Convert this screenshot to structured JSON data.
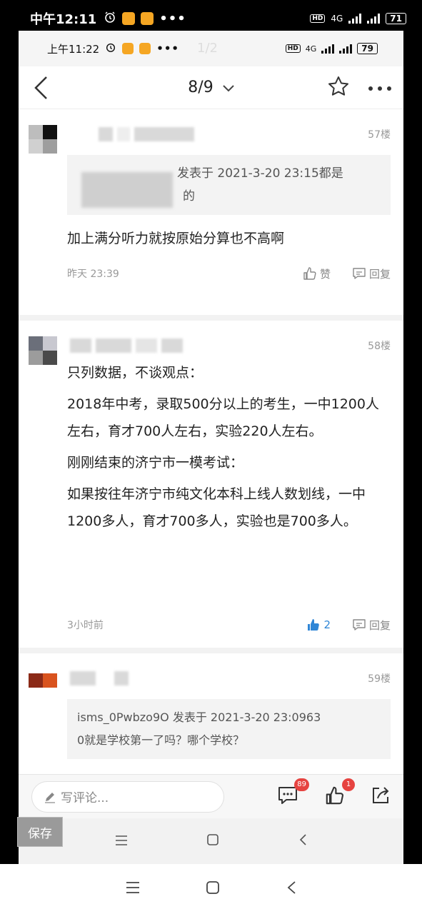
{
  "outer_status": {
    "time": "中午12:11",
    "hd": "HD",
    "network": "4G",
    "battery": "71"
  },
  "inner_status": {
    "time": "上午11:22",
    "hd": "HD",
    "network": "4G",
    "battery": "79",
    "page_indicator": "1/2"
  },
  "nav": {
    "title": "8/9"
  },
  "posts": [
    {
      "floor": "57楼",
      "quote": "发表于 2021-3-20 23:15都是",
      "quote_line2": "的",
      "content": [
        "加上满分听力就按原始分算也不高啊"
      ],
      "time": "昨天 23:39",
      "like_label": "赞",
      "reply_label": "回复",
      "avatar_colors": [
        "#bdbdbd",
        "#111111",
        "#d0d0d0",
        "#9e9e9e"
      ]
    },
    {
      "floor": "58楼",
      "content": [
        "只列数据，不谈观点：",
        "2018年中考，录取500分以上的考生，一中1200人左右，育才700人左右，实验220人左右。",
        "刚刚结束的济宁市一模考试：",
        "如果按往年济宁市纯文化本科上线人数划线，一中1200多人，育才700多人，实验也是700多人。"
      ],
      "time": "3小时前",
      "like_count": "2",
      "reply_label": "回复",
      "avatar_colors": [
        "#6b6f7a",
        "#c8c8d0",
        "#9c9c9c",
        "#4a4a4a"
      ]
    },
    {
      "floor": "59楼",
      "quote": "isms_0Pwbzo9O 发表于 2021-3-20 23:0963",
      "quote_line2": "0就是学校第一了吗？哪个学校？",
      "avatar_colors": [
        "#8b2a17",
        "#d9531e"
      ]
    }
  ],
  "bottom_bar": {
    "placeholder": "写评论...",
    "comment_badge": "89",
    "like_badge": "1"
  },
  "save_button": "保存"
}
